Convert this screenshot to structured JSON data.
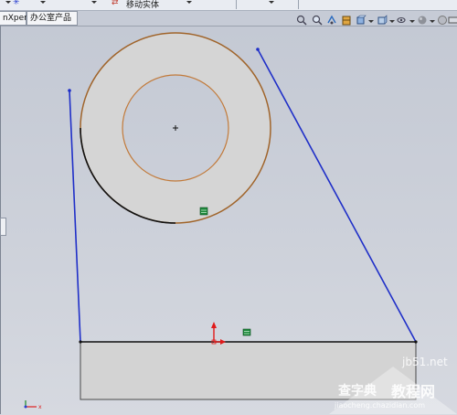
{
  "toolbar": {
    "move_entity_label": "移动实体"
  },
  "tabs": [
    {
      "label": "nXpert"
    },
    {
      "label": "办公室产品"
    }
  ],
  "view_toolbar": {
    "icons": [
      "zoom-to-fit-icon",
      "zoom-area-icon",
      "previous-view-icon",
      "section-view-icon",
      "view-orientation-icon",
      "display-style-icon",
      "hide-show-items-icon",
      "edit-appearance-icon",
      "apply-scene-icon",
      "view-settings-icon"
    ]
  },
  "watermark": {
    "line1": "jb51.net",
    "line2": "查字典",
    "line3": "教程网",
    "line4": "jiaocheng.chazidian.com"
  },
  "colors": {
    "canvas_top": "#c4c9d4",
    "sketch_line_blue": "#1f2fc8",
    "circle_edge_brown": "#a0642a",
    "relation_green": "#1e8a3c",
    "origin_red": "#e01a1a"
  }
}
